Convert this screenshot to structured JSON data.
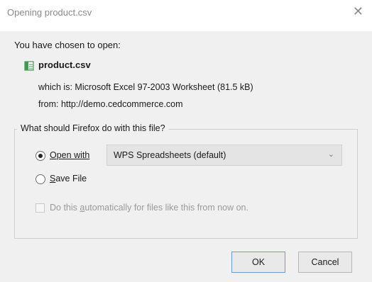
{
  "dialog": {
    "title": "Opening product.csv",
    "close_glyph": "✕",
    "intro_text": "You have chosen to open:",
    "file": {
      "icon": "spreadsheet-file-icon",
      "name": "product.csv",
      "which_is": "which is:  Microsoft Excel 97-2003 Worksheet (81.5 kB)",
      "from": "from:  http://demo.cedcommerce.com"
    },
    "action_group": {
      "legend": "What should Firefox do with this file?",
      "open_with": {
        "label_first": "O",
        "label_rest": "pen with",
        "checked": true
      },
      "app_select": {
        "selected": "WPS Spreadsheets (default)",
        "chevron_glyph": "⌄"
      },
      "save_file": {
        "label_first": "S",
        "label_rest": "ave File",
        "checked": false
      },
      "auto_checkbox": {
        "label_pre": "Do this ",
        "label_u": "a",
        "label_post": "utomatically for files like this from now on.",
        "checked": false,
        "enabled": false
      }
    },
    "buttons": {
      "ok": "OK",
      "cancel": "Cancel"
    },
    "colors": {
      "background": "#f0f0f0",
      "titlebar": "#ffffff",
      "ok_border": "#6a9bd8",
      "icon_green": "#3f9b4e"
    }
  }
}
